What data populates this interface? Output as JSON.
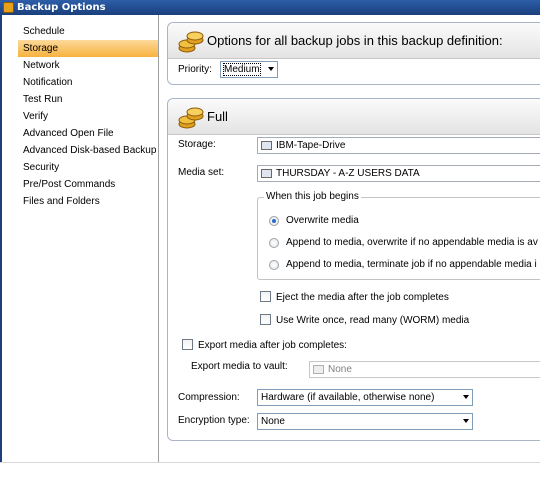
{
  "window": {
    "title": "Backup Options"
  },
  "sidebar": {
    "items": [
      {
        "label": "Schedule"
      },
      {
        "label": "Storage",
        "selected": true
      },
      {
        "label": "Network"
      },
      {
        "label": "Notification"
      },
      {
        "label": "Test Run"
      },
      {
        "label": "Verify"
      },
      {
        "label": "Advanced Open File"
      },
      {
        "label": "Advanced Disk-based Backup"
      },
      {
        "label": "Security"
      },
      {
        "label": "Pre/Post Commands"
      },
      {
        "label": "Files and Folders"
      }
    ]
  },
  "options_panel": {
    "title": "Options for all backup jobs in this backup definition:",
    "priority_label": "Priority:",
    "priority_value": "Medium"
  },
  "full_panel": {
    "title": "Full",
    "storage_label": "Storage:",
    "storage_value": "IBM-Tape-Drive",
    "media_set_label": "Media set:",
    "media_set_value": "THURSDAY - A-Z USERS DATA",
    "job_begins": {
      "legend": "When this job begins",
      "options": [
        {
          "label": "Overwrite media",
          "checked": true
        },
        {
          "label": "Append to media, overwrite if no appendable media is av",
          "checked": false
        },
        {
          "label": "Append to media, terminate job if no appendable media i",
          "checked": false
        }
      ]
    },
    "eject_label": "Eject the media after the job completes",
    "eject_checked": false,
    "worm_label": "Use Write once, read many (WORM) media",
    "worm_checked": false,
    "export_label": "Export media after job completes:",
    "export_checked": false,
    "vault_label": "Export media to vault:",
    "vault_value": "None",
    "compression_label": "Compression:",
    "compression_value": "Hardware (if available, otherwise none)",
    "encryption_label": "Encryption type:",
    "encryption_value": "None"
  },
  "colors": {
    "title_bar": "#1b3f7c",
    "selected_item": "#f7b23f",
    "radio_dot": "#2a6bd0"
  }
}
